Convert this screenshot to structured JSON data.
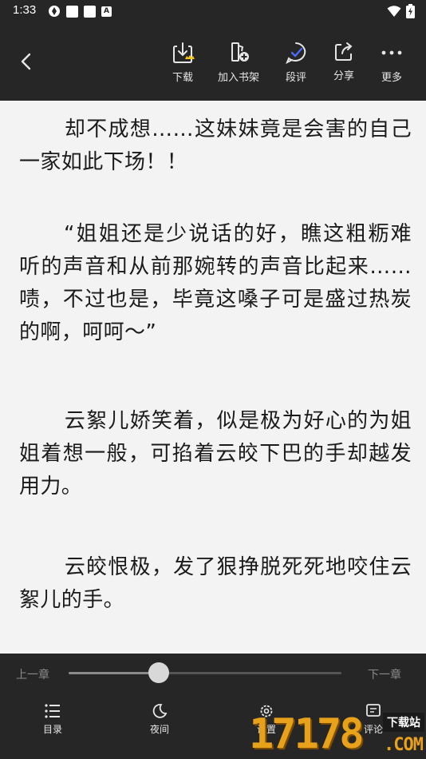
{
  "status_bar": {
    "time": "1:33",
    "notification_badge": "A"
  },
  "toolbar": {
    "back_icon": "chevron-left-icon",
    "items": [
      {
        "label": "下载",
        "icon": "download-icon"
      },
      {
        "label": "加入书架",
        "icon": "add-to-shelf-icon"
      },
      {
        "label": "段评",
        "icon": "comment-icon"
      },
      {
        "label": "分享",
        "icon": "share-icon"
      },
      {
        "label": "更多",
        "icon": "more-icon"
      }
    ]
  },
  "content": {
    "paragraphs": [
      "却不成想……这妹妹竟是会害的自己一家如此下场！！",
      "“姐姐还是少说话的好，瞧这粗粝难听的声音和从前那婉转的声音比起来……啧，不过也是，毕竟这嗓子可是盛过热炭的啊，呵呵～”",
      "云絮儿娇笑着，似是极为好心的为姐姐着想一般，可掐着云皎下巴的手却越发用力。",
      "云皎恨极，发了狠挣脱死死地咬住云絮儿的手。"
    ]
  },
  "reader_controls": {
    "prev_chapter": "上一章",
    "next_chapter": "下一章",
    "progress": 0.33,
    "nav": [
      {
        "label": "目录",
        "icon": "list-icon"
      },
      {
        "label": "夜间",
        "icon": "moon-icon"
      },
      {
        "label": "设置",
        "icon": "settings-icon"
      },
      {
        "label": "评论",
        "icon": "comment-icon"
      }
    ]
  },
  "watermark": {
    "number": "17178",
    "tag": "下载站",
    "domain": ".COM"
  },
  "colors": {
    "bar_bg": "#262626",
    "page_bg": "#f3f3f3",
    "text": "#1b1b1b",
    "accent": "#4a6cf7",
    "watermark": "#e8a11a"
  }
}
